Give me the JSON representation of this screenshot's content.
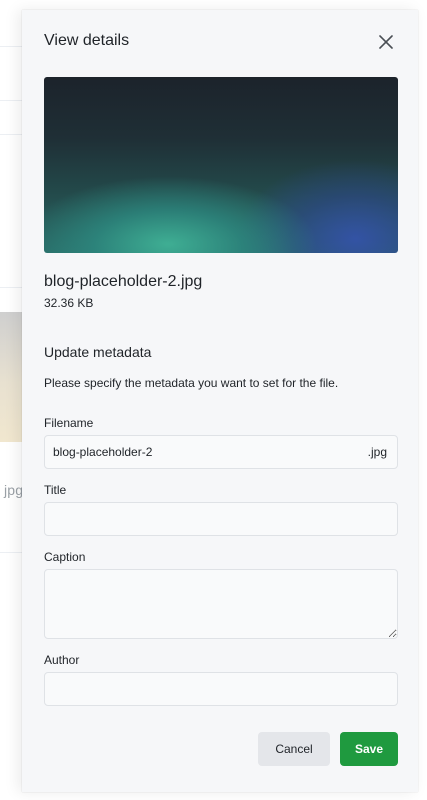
{
  "background": {
    "partial_text": "jpg"
  },
  "panel": {
    "title": "View details",
    "close_icon": "close-icon"
  },
  "file": {
    "name": "blog-placeholder-2.jpg",
    "size": "32.36 KB"
  },
  "metadata": {
    "title": "Update metadata",
    "description": "Please specify the metadata you want to set for the file.",
    "fields": {
      "filename": {
        "label": "Filename",
        "value": "blog-placeholder-2",
        "extension": ".jpg"
      },
      "title": {
        "label": "Title",
        "value": ""
      },
      "caption": {
        "label": "Caption",
        "value": ""
      },
      "author": {
        "label": "Author",
        "value": ""
      }
    }
  },
  "actions": {
    "cancel_label": "Cancel",
    "save_label": "Save"
  },
  "colors": {
    "panel_bg": "#f6f7f9",
    "save_button": "#1f9a3f",
    "cancel_button": "#e4e6ea"
  }
}
